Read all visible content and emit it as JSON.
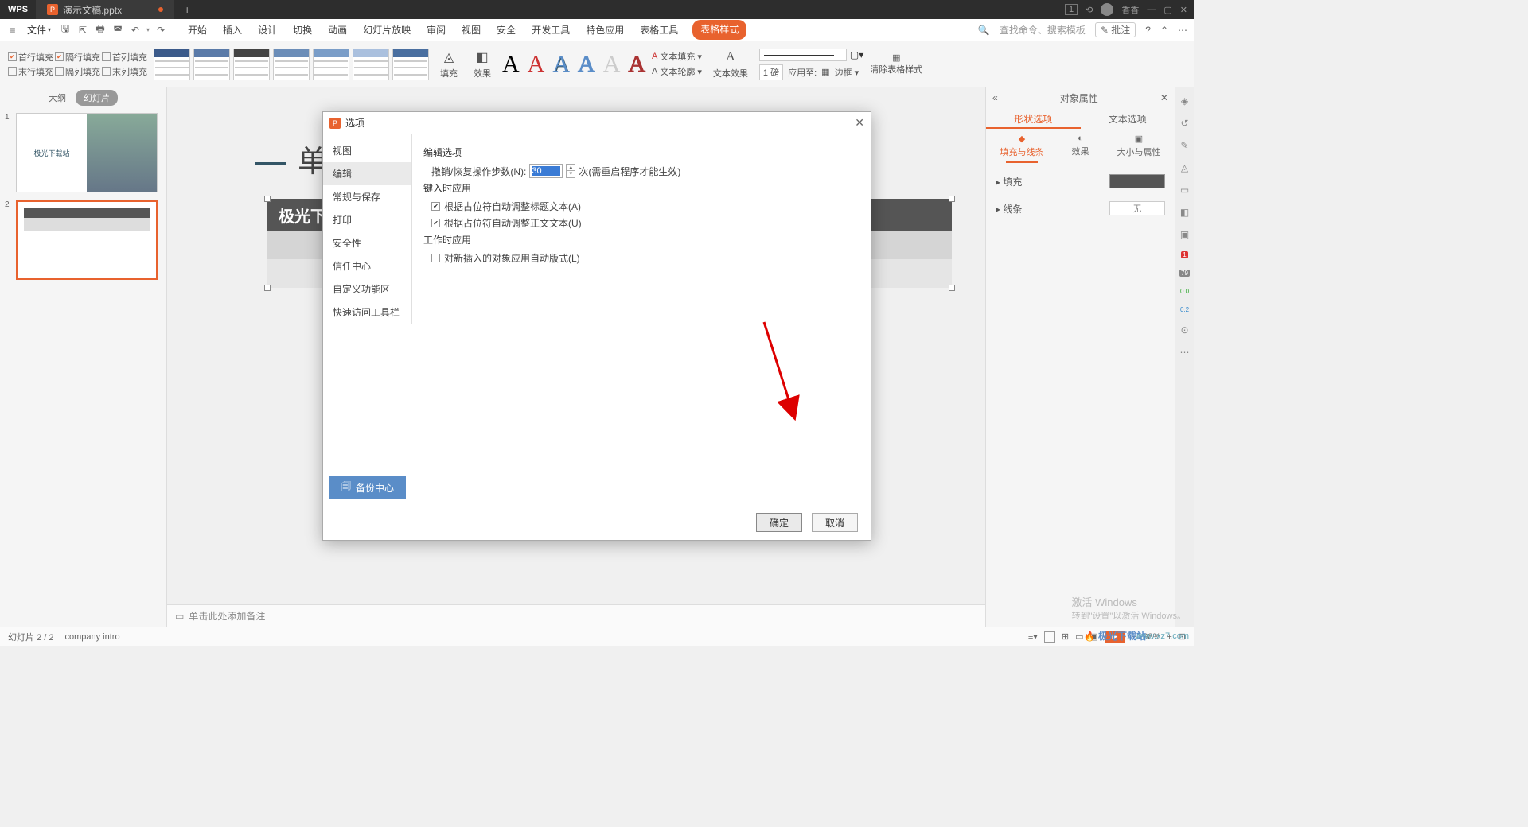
{
  "titleBar": {
    "app": "WPS",
    "tabName": "演示文稿.pptx",
    "userLabel": "香香",
    "badge1": "1"
  },
  "menu": {
    "file": "文件",
    "tabs": [
      "开始",
      "插入",
      "设计",
      "切换",
      "动画",
      "幻灯片放映",
      "审阅",
      "视图",
      "安全",
      "开发工具",
      "特色应用",
      "表格工具",
      "表格样式"
    ],
    "search": "查找命令、搜索模板",
    "batch": "批注"
  },
  "ribbon": {
    "chk": {
      "hdr": "首行填充",
      "stripe": "隔行填充",
      "firstcol": "首列填充",
      "lastrow": "末行填充",
      "stripec": "隔列填充",
      "lastcol": "末列填充"
    },
    "fill": "填充",
    "effect": "效果",
    "textFill": "文本填充",
    "textOutline": "文本轮廓",
    "textEffect": "文本效果",
    "pt": "1 磅",
    "apply": "应用至:",
    "border": "边框",
    "clear": "清除表格样式"
  },
  "panel": {
    "outline": "大纲",
    "slides": "幻灯片",
    "thumb1": "极光下载站"
  },
  "canvas": {
    "title": "单击此",
    "tableHdr": "极光下载站",
    "notes": "单击此处添加备注"
  },
  "prop": {
    "title": "对象属性",
    "tab1": "形状选项",
    "tab2": "文本选项",
    "sub1": "填充与线条",
    "sub2": "效果",
    "sub3": "大小与属性",
    "fill": "填充",
    "line": "线条",
    "none": "无"
  },
  "status": {
    "slide": "幻灯片 2 / 2",
    "intro": "company intro",
    "zoom": "98%"
  },
  "dialog": {
    "title": "选项",
    "nav": [
      "视图",
      "编辑",
      "常规与保存",
      "打印",
      "安全性",
      "信任中心",
      "自定义功能区",
      "快速访问工具栏"
    ],
    "backup": "备份中心",
    "sectEdit": "编辑选项",
    "undoLabel": "撤销/恢复操作步数(N):",
    "undoValue": "30",
    "undoSuffix": "次(需重启程序才能生效)",
    "sectTyping": "键入时应用",
    "autoTitle": "根据占位符自动调整标题文本(A)",
    "autoBody": "根据占位符自动调整正文文本(U)",
    "sectWork": "工作时应用",
    "autoLayout": "对新插入的对象应用自动版式(L)",
    "ok": "确定",
    "cancel": "取消"
  },
  "watermark": {
    "l1": "激活 Windows",
    "l2": "转到\"设置\"以激活 Windows。",
    "site": "www.xz7.com",
    "brand": "极光下载站"
  }
}
